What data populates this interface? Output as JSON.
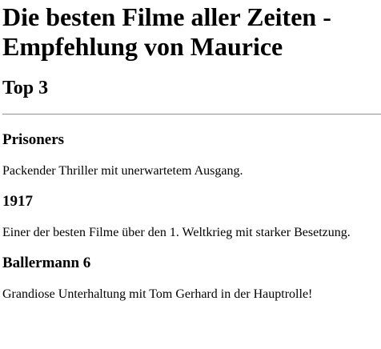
{
  "page": {
    "title": "Die besten Filme aller Zeiten - Empfehlung von Maurice",
    "subtitle": "Top 3"
  },
  "movies": [
    {
      "title": "Prisoners",
      "description": "Packender Thriller mit unerwartetem Ausgang."
    },
    {
      "title": "1917",
      "description": "Einer der besten Filme über den 1. Weltkrieg mit starker Besetzung."
    },
    {
      "title": "Ballermann 6",
      "description": "Grandiose Unterhaltung mit Tom Gerhard in der Hauptrolle!"
    }
  ]
}
